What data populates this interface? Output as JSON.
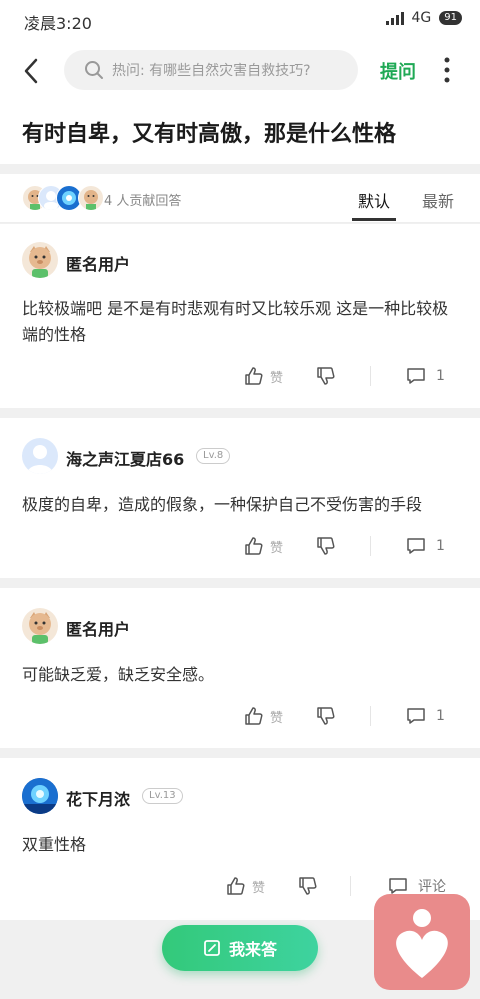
{
  "status": {
    "time": "凌晨3:20",
    "network": "4G",
    "battery": "91"
  },
  "header": {
    "search_placeholder": "热问: 有哪些自然灾害自救技巧?",
    "ask_label": "提问"
  },
  "question": {
    "title": "有时自卑，又有时高傲，那是什么性格"
  },
  "tabs": {
    "contributors": "4 人贡献回答",
    "items": [
      "默认",
      "最新"
    ],
    "active": "默认"
  },
  "answers": [
    {
      "user": "匿名用户",
      "level": "",
      "text": "比较极端吧   是不是有时悲观有时又比较乐观   这是一种比较极端的性格",
      "like": "赞",
      "comments": "1"
    },
    {
      "user": "海之声江夏店66",
      "level": "Lv.8",
      "text": "极度的自卑，造成的假象，一种保护自己不受伤害的手段",
      "like": "赞",
      "comments": "1"
    },
    {
      "user": "匿名用户",
      "level": "",
      "text": "可能缺乏爱，缺乏安全感。",
      "like": "赞",
      "comments": "1"
    },
    {
      "user": "花下月浓",
      "level": "Lv.13",
      "text": "双重性格",
      "like": "赞",
      "comments": "评论"
    }
  ],
  "fab": {
    "label": "我来答"
  },
  "icons": [
    "back-icon",
    "search-icon",
    "more-icon",
    "like-icon",
    "dislike-icon",
    "comment-icon",
    "edit-icon",
    "app-logo"
  ],
  "colors": {
    "accent": "#1fa955",
    "fab_start": "#33c97a",
    "fab_end": "#3ed39f",
    "logo": "#e98b8b"
  }
}
